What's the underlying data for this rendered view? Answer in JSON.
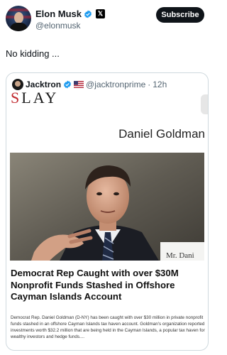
{
  "author": {
    "name": "Elon Musk",
    "handle": "@elonmusk",
    "subscribe_label": "Subscribe"
  },
  "tweet": {
    "text": "No kidding ..."
  },
  "quoted": {
    "name": "Jacktron",
    "handle": "@jacktronprime",
    "separator": "·",
    "time": "12h",
    "brand_s": "S",
    "brand_rest": "LAY",
    "byline": "Daniel Goldman",
    "placard_text": "Mr. Dani",
    "headline": "Democrat Rep Caught with over $30M Nonprofit Funds Stashed in Offshore Cayman Islands Account",
    "summary": "Democrat Rep. Daniel Goldman (D-NY) has been caught with over $30 million in private nonprofit funds stashed in an offshore Cayman Islands tax haven account. Goldman's organization reported investments worth $32.2 million that are being held in the Cayman Islands, a popular tax haven for wealthy investors and hedge funds...."
  },
  "colors": {
    "verified_blue": "#1d9bf0",
    "slay_red": "#c0282d",
    "text_secondary": "#536471"
  },
  "icons": [
    "verified-badge-icon",
    "x-logo-icon",
    "us-flag-icon"
  ]
}
